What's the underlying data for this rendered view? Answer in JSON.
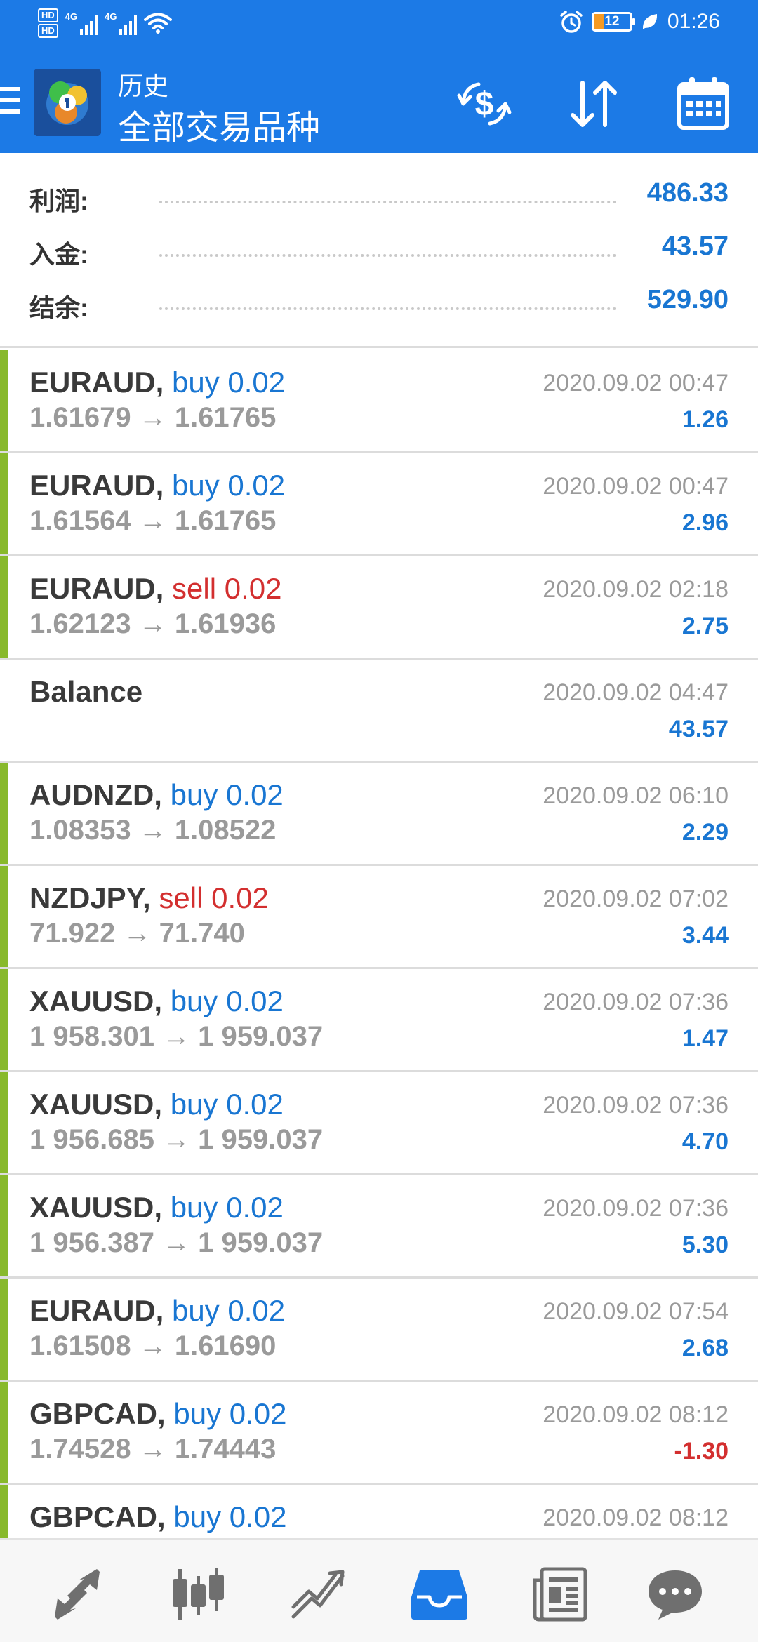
{
  "status_bar": {
    "hd1": "HD",
    "hd2": "HD",
    "net1": "4G",
    "net2": "4G",
    "battery": "12",
    "time": "01:26"
  },
  "header": {
    "subtitle": "历史",
    "title": "全部交易品种",
    "actions": [
      "currency-exchange-icon",
      "sort-icon",
      "calendar-icon"
    ]
  },
  "summary": {
    "profit_label": "利润:",
    "profit_value": "486.33",
    "deposit_label": "入金:",
    "deposit_value": "43.57",
    "balance_label": "结余:",
    "balance_value": "529.90"
  },
  "deals": [
    {
      "symbol": "EURAUD,",
      "side": "buy 0.02",
      "side_type": "buy",
      "prices": "1.61679 → 1.61765",
      "time": "2020.09.02 00:47",
      "profit": "1.26"
    },
    {
      "symbol": "EURAUD,",
      "side": "buy 0.02",
      "side_type": "buy",
      "prices": "1.61564 → 1.61765",
      "time": "2020.09.02 00:47",
      "profit": "2.96"
    },
    {
      "symbol": "EURAUD,",
      "side": "sell 0.02",
      "side_type": "sell",
      "prices": "1.62123 → 1.61936",
      "time": "2020.09.02 02:18",
      "profit": "2.75"
    },
    {
      "symbol": "Balance",
      "side": "",
      "side_type": "balance",
      "prices": "",
      "time": "2020.09.02 04:47",
      "profit": "43.57"
    },
    {
      "symbol": "AUDNZD,",
      "side": "buy 0.02",
      "side_type": "buy",
      "prices": "1.08353 → 1.08522",
      "time": "2020.09.02 06:10",
      "profit": "2.29"
    },
    {
      "symbol": "NZDJPY,",
      "side": "sell 0.02",
      "side_type": "sell",
      "prices": "71.922 → 71.740",
      "time": "2020.09.02 07:02",
      "profit": "3.44"
    },
    {
      "symbol": "XAUUSD,",
      "side": "buy 0.02",
      "side_type": "buy",
      "prices": "1 958.301 → 1 959.037",
      "time": "2020.09.02 07:36",
      "profit": "1.47"
    },
    {
      "symbol": "XAUUSD,",
      "side": "buy 0.02",
      "side_type": "buy",
      "prices": "1 956.685 → 1 959.037",
      "time": "2020.09.02 07:36",
      "profit": "4.70"
    },
    {
      "symbol": "XAUUSD,",
      "side": "buy 0.02",
      "side_type": "buy",
      "prices": "1 956.387 → 1 959.037",
      "time": "2020.09.02 07:36",
      "profit": "5.30"
    },
    {
      "symbol": "EURAUD,",
      "side": "buy 0.02",
      "side_type": "buy",
      "prices": "1.61508 → 1.61690",
      "time": "2020.09.02 07:54",
      "profit": "2.68"
    },
    {
      "symbol": "GBPCAD,",
      "side": "buy 0.02",
      "side_type": "buy",
      "prices": "1.74528 → 1.74443",
      "time": "2020.09.02 08:12",
      "profit": "-1.30"
    },
    {
      "symbol": "GBPCAD,",
      "side": "buy 0.02",
      "side_type": "buy",
      "prices": "",
      "time": "2020.09.02 08:12",
      "profit": ""
    }
  ],
  "bottom_nav": [
    "quotes-icon",
    "chart-icon",
    "trade-icon",
    "history-icon",
    "news-icon",
    "messages-icon"
  ],
  "colors": {
    "header_bg": "#1c7ae6",
    "buy": "#1976d2",
    "sell": "#d32f2f",
    "profit_bar": "#88b92c",
    "active_nav": "#1c7ae6",
    "inactive_nav": "#6f6f6f"
  }
}
